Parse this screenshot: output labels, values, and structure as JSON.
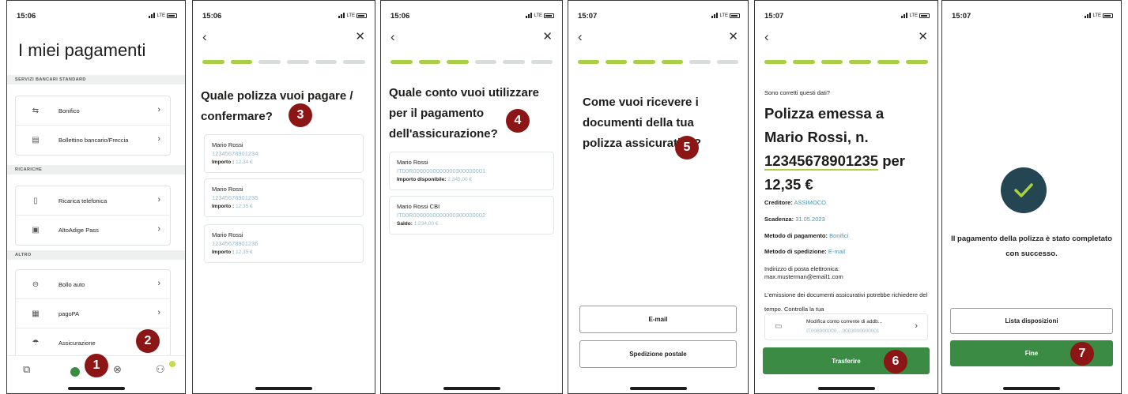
{
  "status": {
    "t1": "15:06",
    "t2": "15:06",
    "t3": "15:06",
    "t4": "15:07",
    "t5": "15:07",
    "t6": "15:07",
    "network": "LTE"
  },
  "steps": {
    "s1": "1",
    "s2": "2",
    "s3": "3",
    "s4": "4",
    "s5": "5",
    "s6": "6",
    "s7": "7"
  },
  "screen1": {
    "title": "I miei pagamenti",
    "sections": [
      "SERVIZI BANCARI STANDARD",
      "RICARICHE",
      "ALTRO"
    ],
    "items": [
      "Bonifico",
      "Bollettino bancario/Freccia",
      "Ricarica telefonica",
      "AltoAdige Pass",
      "Bollo auto",
      "pagoPA",
      "Assicurazione"
    ]
  },
  "screen2": {
    "title": "Quale polizza vuoi pagare / confermare?",
    "amount_label": "Importo :",
    "policies": [
      {
        "name": "Mario Rossi",
        "number": "12345678901234",
        "amount": "12,34 €"
      },
      {
        "name": "Mario Rossi",
        "number": "12345678901235",
        "amount": "12,35 €"
      },
      {
        "name": "Mario Rossi",
        "number": "12345678901236",
        "amount": "12,35 €"
      }
    ]
  },
  "screen3": {
    "title": "Quale conto vuoi utilizzare per il pagamento dell'assicurazione?",
    "accounts": [
      {
        "name": "Mario Rossi",
        "iban": "IT00R0000000000000300000001",
        "label": "Importo disponibile:",
        "value": "2.345,00 €"
      },
      {
        "name": "Mario Rossi CBI",
        "iban": "IT00R0000000000000300000002",
        "label": "Saldo:",
        "value": "1.234,00 €"
      }
    ]
  },
  "screen4": {
    "title": "Come vuoi ricevere i documenti della tua polizza assicurativa?",
    "btn_email": "E-mail",
    "btn_post": "Spedizione postale"
  },
  "screen5": {
    "question": "Sono corretti questi dati?",
    "title_pre": "Polizza emessa a Mario Rossi, n.",
    "title_num": "12345678901235",
    "title_post": "per 12,35 €",
    "creditor_label": "Creditore:",
    "creditor": "ASSIMOCO",
    "due_label": "Scadenza:",
    "due": "31.05.2023",
    "method_label": "Metodo di pagamento:",
    "method": "Bonifici",
    "ship_label": "Metodo di spedizione:",
    "ship": "E-mail",
    "email_label": "Indirizzo di posta elettronica:",
    "email": "max.musterman@email1.com",
    "note": "L'emissione dei documenti assicurativi potrebbe richiedere del tempo. Controlla la tua",
    "change": "Modifica conto corrente di addb...",
    "change_iban": "IT008000000....0003000000001",
    "btn": "Trasferire"
  },
  "screen6": {
    "message": "Il pagamento della polizza è stato completato con successo.",
    "btn_list": "Lista disposizioni",
    "btn_done": "Fine"
  }
}
